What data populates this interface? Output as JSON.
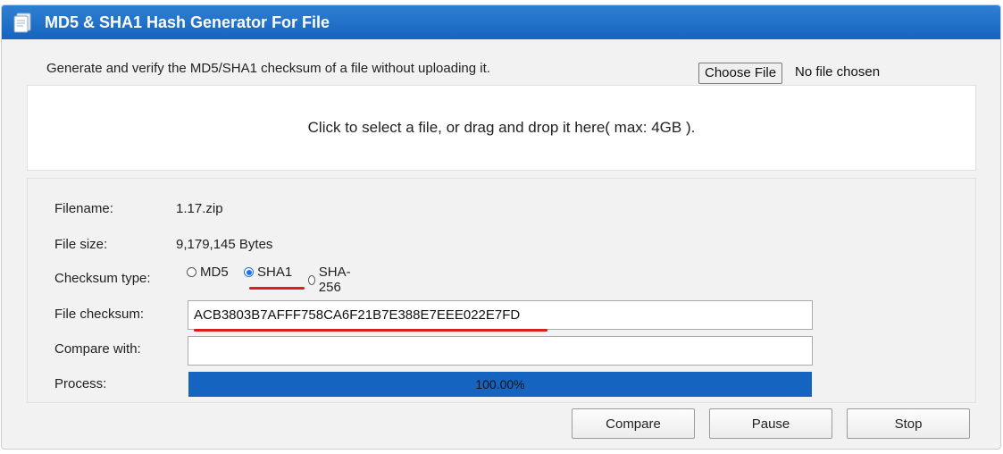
{
  "window": {
    "title": "MD5 & SHA1 Hash Generator For File",
    "icon": "document-icon",
    "accent_color": "#1565c0"
  },
  "intro": {
    "text": "Generate and verify the MD5/SHA1 checksum of a file without uploading it.",
    "choose_file_label": "Choose File",
    "no_file_text": "No file chosen"
  },
  "dropzone": {
    "text": "Click to select a file, or drag and drop it here( max: 4GB )."
  },
  "info": {
    "filename_label": "Filename:",
    "filename_value": "1.17.zip",
    "filesize_label": "File size:",
    "filesize_value": "9,179,145 Bytes",
    "checksum_type_label": "Checksum type:",
    "checksum_types": [
      {
        "label": "MD5",
        "checked": false
      },
      {
        "label": "SHA1",
        "checked": true
      },
      {
        "label": "SHA-256",
        "checked": false
      }
    ],
    "file_checksum_label": "File checksum:",
    "file_checksum_value": "ACB3803B7AFFF758CA6F21B7E388E7EEE022E7FD",
    "compare_label": "Compare with:",
    "compare_value": "",
    "process_label": "Process:",
    "progress_fraction": 1.0,
    "progress_text": "100.00%"
  },
  "buttons": {
    "compare": "Compare",
    "pause": "Pause",
    "stop": "Stop"
  },
  "annotation_color": "#d91c1c"
}
